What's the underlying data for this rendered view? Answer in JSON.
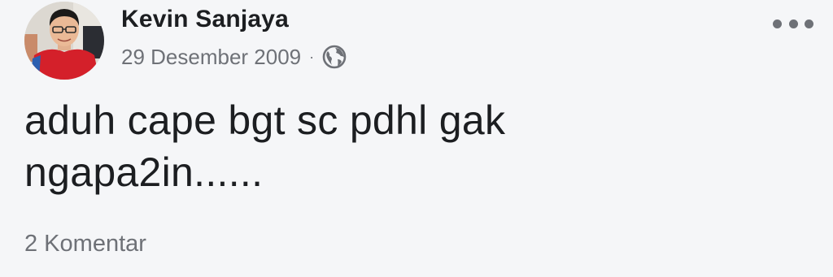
{
  "post": {
    "author": "Kevin Sanjaya",
    "date": "29 Desember 2009",
    "separator": "·",
    "privacy_icon": "globe-icon",
    "more_icon": "more-options-icon",
    "text_line_1": "aduh cape bgt sc pdhl gak",
    "text_line_2": "ngapa2in......",
    "comments_label": "2 Komentar"
  },
  "colors": {
    "background": "#f5f6f8",
    "primary_text": "#1c1e21",
    "secondary_text": "#6e7177"
  }
}
